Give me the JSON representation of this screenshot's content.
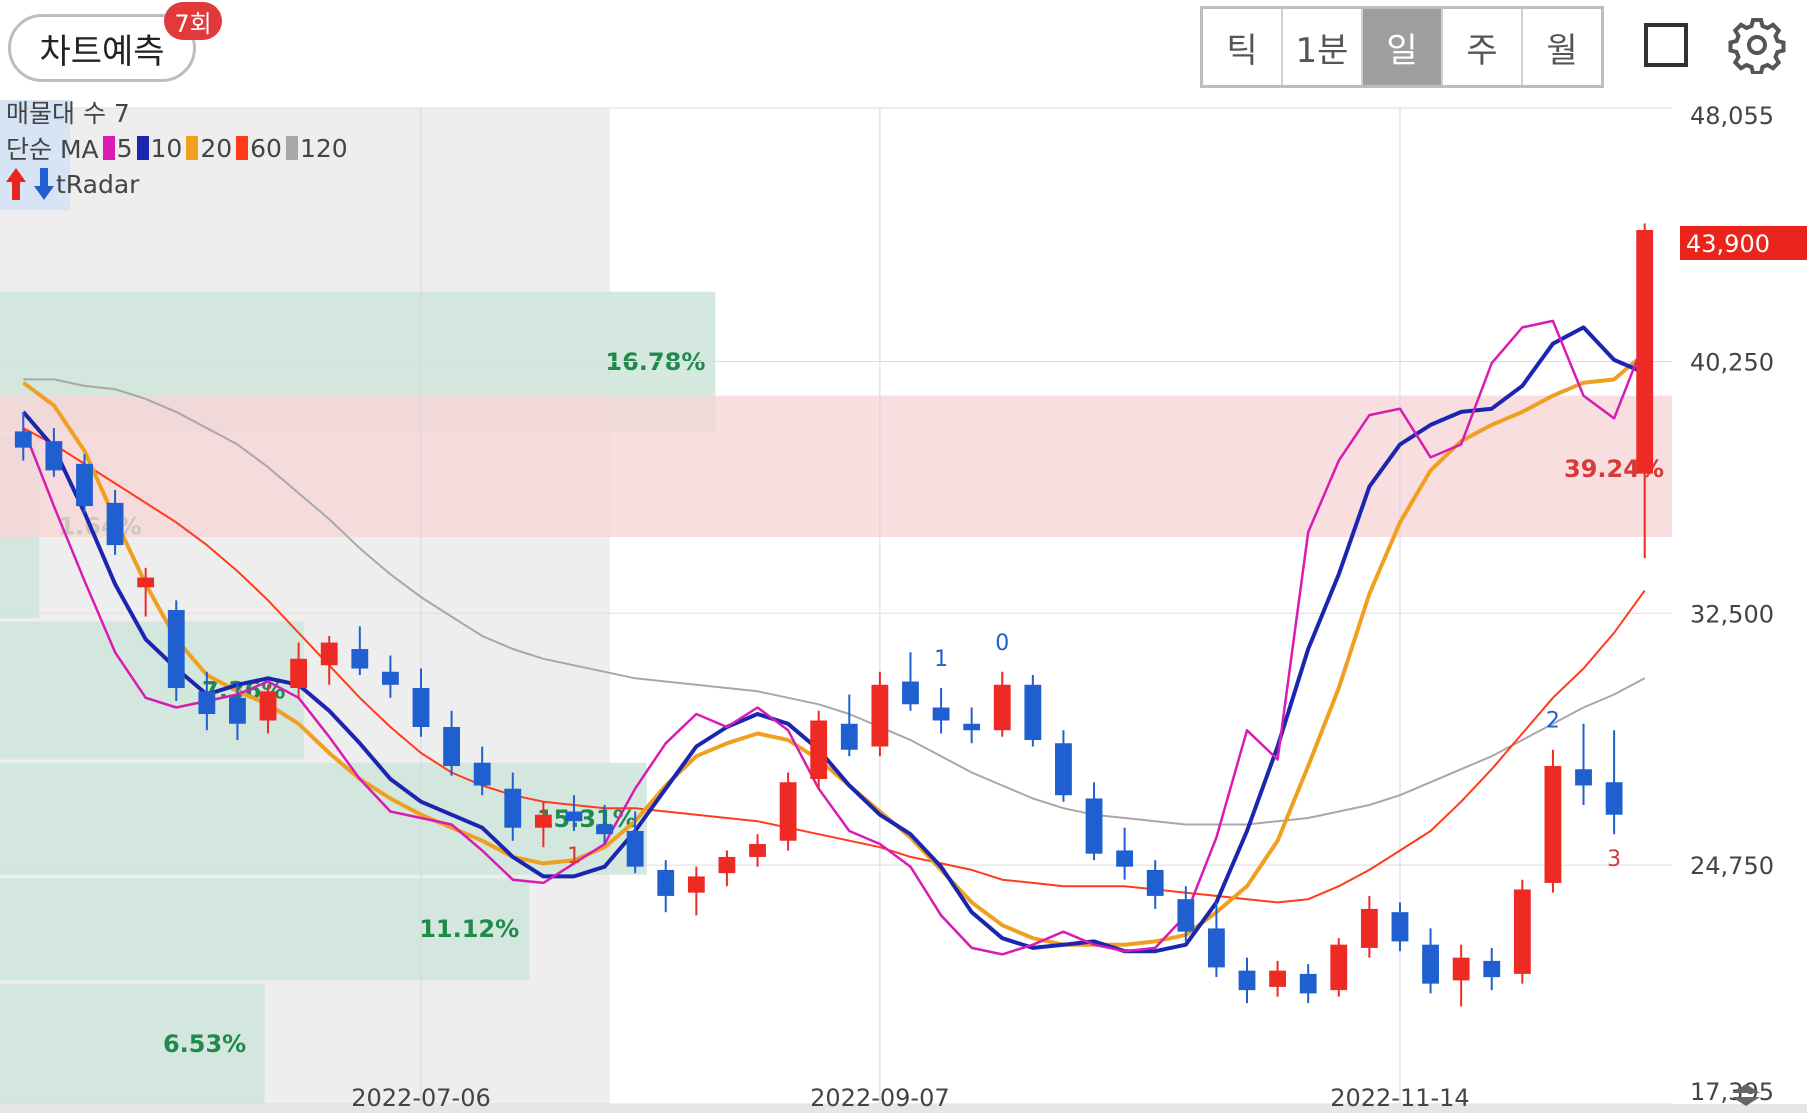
{
  "toolbar": {
    "forecast_label": "차트예측",
    "forecast_badge": "7회",
    "period_tabs": [
      "틱",
      "1분",
      "일",
      "주",
      "월"
    ],
    "active_tab": "일",
    "fullscreen_icon": "square-outline-icon",
    "settings_icon": "gear-icon"
  },
  "legend": {
    "volume_profile": "매물대 수 7",
    "ma_label": "단순 MA",
    "ma_periods": [
      {
        "period": "5",
        "color": "#d81bb3"
      },
      {
        "period": "10",
        "color": "#1b26b0"
      },
      {
        "period": "20",
        "color": "#f0a020"
      },
      {
        "period": "60",
        "color": "#ff3b1a"
      },
      {
        "period": "120",
        "color": "#a8a8a8"
      }
    ],
    "tradar_label": "tRadar",
    "tradar_icons": [
      "up-arrow-icon",
      "down-arrow-icon"
    ]
  },
  "chart_data": {
    "type": "candlestick",
    "y_axis_ticks": [
      "48,055",
      "40,250",
      "32,500",
      "24,750",
      "17,395"
    ],
    "ylim": [
      17395,
      48055
    ],
    "x_axis_labels": [
      "2022-07-06",
      "2022-09-07",
      "2022-11-14"
    ],
    "current_price": "43,900",
    "colors": {
      "up": "#ee2a24",
      "down": "#1f5fcf",
      "current_price_tag": "#e8241c"
    },
    "volume_profile": [
      {
        "range": [
          38080,
          42400
        ],
        "percent": "16.78%",
        "fill": 0.73
      },
      {
        "range": [
          32350,
          37980
        ],
        "percent": "1.64%",
        "fill": 0.04
      },
      {
        "range": [
          28000,
          32250
        ],
        "percent": "7.36%",
        "fill": 0.31
      },
      {
        "range": [
          24450,
          27900
        ],
        "percent": "15.31%",
        "fill": 0.66
      },
      {
        "range": [
          21200,
          24350
        ],
        "percent": "11.12%",
        "fill": 0.54
      },
      {
        "range": [
          17395,
          21100
        ],
        "percent": "6.53%",
        "fill": 0.27
      }
    ],
    "resistance_band": {
      "low": 34850,
      "high": 39200,
      "label": "39.24%"
    },
    "ma_series": {
      "ma5": [
        38200,
        35800,
        33500,
        31300,
        29900,
        29600,
        29800,
        30000,
        30400,
        29900,
        28700,
        27400,
        26400,
        26200,
        26000,
        25200,
        24300,
        24200,
        24800,
        25400,
        27100,
        28500,
        29400,
        29000,
        29600,
        28900,
        27100,
        25800,
        25400,
        24700,
        23200,
        22200,
        22000,
        22300,
        22700,
        22300,
        22100,
        22200,
        23200,
        25600,
        28900,
        28000,
        35000,
        37200,
        38600,
        38800,
        37300,
        37700,
        40200,
        41300,
        41500,
        39200,
        38500,
        40900
      ],
      "ma10": [
        38700,
        37600,
        35600,
        33400,
        31700,
        30800,
        30000,
        30300,
        30500,
        30300,
        29500,
        28500,
        27400,
        26700,
        26300,
        25900,
        25000,
        24400,
        24400,
        24700,
        25800,
        27100,
        28400,
        29000,
        29400,
        29100,
        28300,
        27200,
        26300,
        25700,
        24700,
        23300,
        22500,
        22200,
        22300,
        22400,
        22100,
        22100,
        22300,
        23600,
        25800,
        28400,
        31400,
        33700,
        36400,
        37700,
        38300,
        38700,
        38800,
        39500,
        40800,
        41300,
        40300,
        39900
      ],
      "ma20": [
        39600,
        38900,
        37500,
        35400,
        33400,
        31700,
        30600,
        30100,
        29700,
        29100,
        28200,
        27400,
        26800,
        26300,
        25900,
        25500,
        25000,
        24800,
        24900,
        25300,
        26100,
        27200,
        28100,
        28500,
        28800,
        28600,
        28000,
        27200,
        26400,
        25600,
        24600,
        23600,
        22900,
        22500,
        22300,
        22300,
        22300,
        22400,
        22600,
        23300,
        24100,
        25500,
        27800,
        30200,
        33100,
        35300,
        36900,
        37800,
        38300,
        38700,
        39200,
        39600,
        39700,
        40500
      ],
      "ma60": [
        38200,
        37700,
        37100,
        36500,
        35900,
        35300,
        34600,
        33800,
        32900,
        31900,
        30900,
        29900,
        29000,
        28200,
        27600,
        27200,
        26900,
        26700,
        26600,
        26500,
        26500,
        26400,
        26300,
        26200,
        26100,
        25900,
        25700,
        25500,
        25300,
        25000,
        24800,
        24600,
        24300,
        24200,
        24100,
        24100,
        24100,
        24000,
        23900,
        23800,
        23700,
        23600,
        23700,
        24100,
        24600,
        25200,
        25800,
        26700,
        27700,
        28800,
        29900,
        30800,
        31900,
        33200
      ],
      "ma120": [
        39700,
        39700,
        39500,
        39400,
        39100,
        38700,
        38200,
        37700,
        37000,
        36200,
        35400,
        34500,
        33700,
        33000,
        32400,
        31800,
        31400,
        31100,
        30900,
        30700,
        30500,
        30400,
        30300,
        30200,
        30100,
        29900,
        29700,
        29400,
        29000,
        28600,
        28100,
        27600,
        27200,
        26800,
        26500,
        26300,
        26200,
        26100,
        26000,
        26000,
        26000,
        26100,
        26200,
        26400,
        26600,
        26900,
        27300,
        27700,
        28100,
        28600,
        29100,
        29600,
        30000,
        30500
      ]
    },
    "candles": [
      {
        "o": 38100,
        "h": 38700,
        "l": 37200,
        "c": 37600
      },
      {
        "o": 37800,
        "h": 38200,
        "l": 36700,
        "c": 36900
      },
      {
        "o": 37100,
        "h": 37400,
        "l": 35600,
        "c": 35800
      },
      {
        "o": 35900,
        "h": 36300,
        "l": 34300,
        "c": 34600
      },
      {
        "o": 33300,
        "h": 33900,
        "l": 32400,
        "c": 33600
      },
      {
        "o": 32600,
        "h": 32900,
        "l": 29800,
        "c": 30200
      },
      {
        "o": 30100,
        "h": 30700,
        "l": 28900,
        "c": 29400
      },
      {
        "o": 29900,
        "h": 30400,
        "l": 28600,
        "c": 29100
      },
      {
        "o": 29200,
        "h": 30300,
        "l": 28800,
        "c": 30100
      },
      {
        "o": 30200,
        "h": 31600,
        "l": 29900,
        "c": 31100
      },
      {
        "o": 30900,
        "h": 31800,
        "l": 30300,
        "c": 31600
      },
      {
        "o": 31400,
        "h": 32100,
        "l": 30600,
        "c": 30800
      },
      {
        "o": 30700,
        "h": 31200,
        "l": 29900,
        "c": 30300
      },
      {
        "o": 30200,
        "h": 30800,
        "l": 28700,
        "c": 29000
      },
      {
        "o": 29000,
        "h": 29500,
        "l": 27500,
        "c": 27800
      },
      {
        "o": 27900,
        "h": 28400,
        "l": 26900,
        "c": 27200
      },
      {
        "o": 27100,
        "h": 27600,
        "l": 25500,
        "c": 25900
      },
      {
        "o": 25900,
        "h": 26700,
        "l": 25300,
        "c": 26300
      },
      {
        "o": 26400,
        "h": 26900,
        "l": 25800,
        "c": 26100
      },
      {
        "o": 26000,
        "h": 26600,
        "l": 25400,
        "c": 25700
      },
      {
        "o": 25800,
        "h": 26400,
        "l": 24500,
        "c": 24700
      },
      {
        "o": 24600,
        "h": 24900,
        "l": 23300,
        "c": 23800
      },
      {
        "o": 23900,
        "h": 24700,
        "l": 23200,
        "c": 24400
      },
      {
        "o": 24500,
        "h": 25200,
        "l": 24100,
        "c": 25000
      },
      {
        "o": 25000,
        "h": 25700,
        "l": 24700,
        "c": 25400
      },
      {
        "o": 25500,
        "h": 27600,
        "l": 25200,
        "c": 27300
      },
      {
        "o": 27400,
        "h": 29500,
        "l": 27100,
        "c": 29200
      },
      {
        "o": 29100,
        "h": 30000,
        "l": 28100,
        "c": 28300
      },
      {
        "o": 28400,
        "h": 30700,
        "l": 28100,
        "c": 30300
      },
      {
        "o": 30400,
        "h": 31300,
        "l": 29500,
        "c": 29700
      },
      {
        "o": 29600,
        "h": 30200,
        "l": 28800,
        "c": 29200
      },
      {
        "o": 29100,
        "h": 29600,
        "l": 28500,
        "c": 28900
      },
      {
        "o": 28900,
        "h": 30700,
        "l": 28700,
        "c": 30300
      },
      {
        "o": 30300,
        "h": 30600,
        "l": 28400,
        "c": 28600
      },
      {
        "o": 28500,
        "h": 28900,
        "l": 26700,
        "c": 26900
      },
      {
        "o": 26800,
        "h": 27300,
        "l": 24900,
        "c": 25100
      },
      {
        "o": 25200,
        "h": 25900,
        "l": 24300,
        "c": 24700
      },
      {
        "o": 24600,
        "h": 24900,
        "l": 23400,
        "c": 23800
      },
      {
        "o": 23700,
        "h": 24100,
        "l": 22400,
        "c": 22700
      },
      {
        "o": 22800,
        "h": 23600,
        "l": 21300,
        "c": 21600
      },
      {
        "o": 21500,
        "h": 21900,
        "l": 20500,
        "c": 20900
      },
      {
        "o": 21000,
        "h": 21800,
        "l": 20700,
        "c": 21500
      },
      {
        "o": 21400,
        "h": 21700,
        "l": 20500,
        "c": 20800
      },
      {
        "o": 20900,
        "h": 22500,
        "l": 20700,
        "c": 22300
      },
      {
        "o": 22200,
        "h": 23800,
        "l": 21900,
        "c": 23400
      },
      {
        "o": 23300,
        "h": 23600,
        "l": 22100,
        "c": 22400
      },
      {
        "o": 22300,
        "h": 22800,
        "l": 20800,
        "c": 21100
      },
      {
        "o": 21200,
        "h": 22300,
        "l": 20400,
        "c": 21900
      },
      {
        "o": 21800,
        "h": 22200,
        "l": 20900,
        "c": 21300
      },
      {
        "o": 21400,
        "h": 24300,
        "l": 21100,
        "c": 24000
      },
      {
        "o": 24200,
        "h": 28300,
        "l": 23900,
        "c": 27800
      },
      {
        "o": 27700,
        "h": 29100,
        "l": 26600,
        "c": 27200
      },
      {
        "o": 27300,
        "h": 28900,
        "l": 25700,
        "c": 26300
      },
      {
        "o": 36800,
        "h": 44500,
        "l": 34200,
        "c": 44300
      }
    ],
    "signal_labels": [
      {
        "text": "2",
        "color": "down"
      },
      {
        "text": "1",
        "color": "down"
      },
      {
        "text": "0",
        "color": "down"
      },
      {
        "text": "3",
        "color": "up"
      },
      {
        "text": "1",
        "color": "up"
      }
    ]
  }
}
